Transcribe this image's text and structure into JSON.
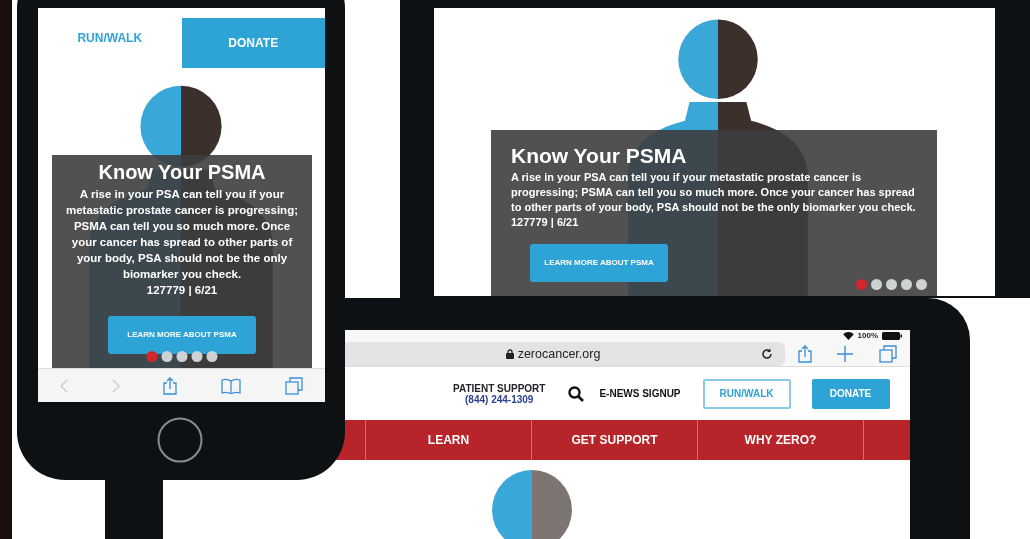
{
  "phone": {
    "tabs": [
      {
        "label": "RUN/WALK",
        "kind": "text"
      },
      {
        "label": "DONATE",
        "kind": "filled"
      }
    ],
    "hero": {
      "title": "Know Your PSMA",
      "body": "A rise in your PSA can tell you if your metastatic prostate cancer is progressing; PSMA can tell you so much more. Once your cancer has spread to other parts of your body, PSA should not be the only biomarker you check.",
      "code": "127779 | 6/21",
      "button": "LEARN MORE ABOUT PSMA",
      "dots": [
        {
          "selected": true
        },
        {
          "selected": false
        },
        {
          "selected": false
        },
        {
          "selected": false
        },
        {
          "selected": false
        }
      ]
    }
  },
  "monitor": {
    "hero": {
      "title": "Know Your PSMA",
      "body": "A rise in your PSA can tell you if your metastatic prostate cancer is progressing; PSMA can tell you so much more. Once your cancer has spread to other parts of your body, PSA should not be the only biomarker you check.",
      "code": "127779 | 6/21",
      "button": "LEARN MORE ABOUT PSMA",
      "dots": [
        {
          "selected": true
        },
        {
          "selected": false
        },
        {
          "selected": false
        },
        {
          "selected": false
        },
        {
          "selected": false
        }
      ]
    }
  },
  "tablet": {
    "status": {
      "battery": "100%"
    },
    "address": "zerocancer.org",
    "header": {
      "support_label": "PATIENT SUPPORT",
      "support_phone": "(844) 244-1309",
      "signup": "E-NEWS SIGNUP",
      "buttons": [
        {
          "label": "RUN/WALK",
          "kind": "outline"
        },
        {
          "label": "DONATE",
          "kind": "filled"
        }
      ]
    },
    "nav": [
      "LEARN",
      "GET SUPPORT",
      "WHY ZERO?"
    ]
  }
}
